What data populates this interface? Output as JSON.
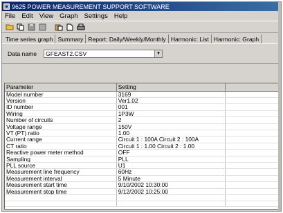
{
  "window": {
    "title": "9625 POWER MEASUREMENT SUPPORT SOFTWARE"
  },
  "menu": [
    "File",
    "Edit",
    "View",
    "Graph",
    "Settings",
    "Help"
  ],
  "toolbar": [
    "folder-open-icon",
    "copy-icon",
    "save-icon",
    "print-preview-icon",
    "paste-icon",
    "page-icon",
    "print-icon"
  ],
  "tabs": [
    "Time series graph",
    "Summary",
    "Report: Daily/Weekly/Monthly",
    "Harmonic: List",
    "Harmonic: Graph"
  ],
  "file": {
    "label": "Data name",
    "value": "GFEAST2.CSV"
  },
  "table": {
    "headers": [
      "Parameter",
      "Setting",
      ""
    ],
    "rows": [
      [
        "Model number",
        "3169"
      ],
      [
        "Version",
        "Ver1.02"
      ],
      [
        "ID number",
        "001"
      ],
      [
        "Wiring",
        "1P3W"
      ],
      [
        "Number of circuits",
        "2"
      ],
      [
        "Voltage range",
        "150V"
      ],
      [
        "VT (PT) ratio",
        "1.00"
      ],
      [
        "Current range",
        "Circuit 1 : 100A Circuit 2 : 100A"
      ],
      [
        "CT ratio",
        "Circuit 1 : 1.00 Circuit 2 : 1.00"
      ],
      [
        "Reactive power meter method",
        "OFF"
      ],
      [
        "Sampling",
        "PLL"
      ],
      [
        "PLL source",
        "U1"
      ],
      [
        "Measurement line frequency",
        "60Hz"
      ],
      [
        "Measurement interval",
        "5 Minute"
      ],
      [
        "Measurement start time",
        "9/10/2002 10:30:00"
      ],
      [
        "Measurement stop time",
        "9/12/2002 10:25:00"
      ],
      [
        "",
        ""
      ],
      [
        "",
        ""
      ]
    ]
  }
}
